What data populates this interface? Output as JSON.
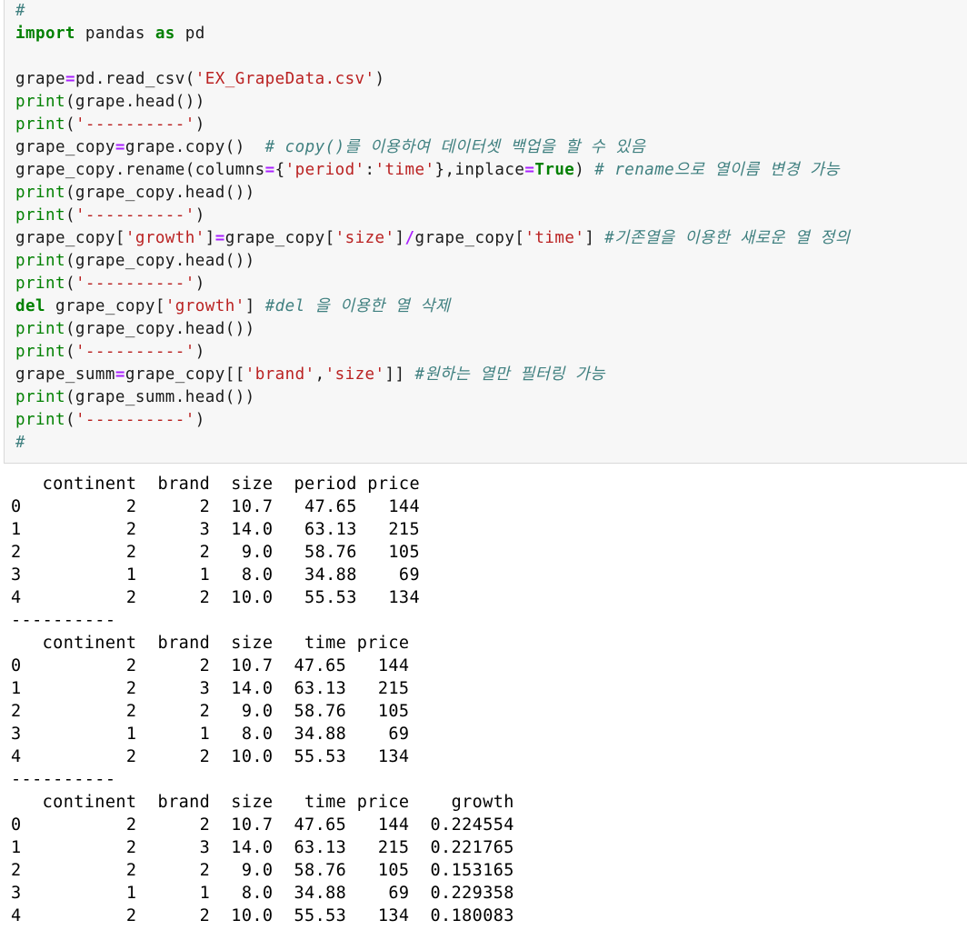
{
  "code_cell": {
    "lines": [
      [
        {
          "t": "#",
          "c": "cm"
        }
      ],
      [
        {
          "t": "import",
          "c": "kw"
        },
        {
          "t": " pandas ",
          "c": ""
        },
        {
          "t": "as",
          "c": "kw"
        },
        {
          "t": " pd",
          "c": ""
        }
      ],
      [
        {
          "t": "",
          "c": ""
        }
      ],
      [
        {
          "t": "grape",
          "c": ""
        },
        {
          "t": "=",
          "c": "op"
        },
        {
          "t": "pd.read_csv(",
          "c": ""
        },
        {
          "t": "'EX_GrapeData.csv'",
          "c": "str"
        },
        {
          "t": ")",
          "c": ""
        }
      ],
      [
        {
          "t": "print",
          "c": "builtin"
        },
        {
          "t": "(grape.head())",
          "c": ""
        }
      ],
      [
        {
          "t": "print",
          "c": "builtin"
        },
        {
          "t": "(",
          "c": ""
        },
        {
          "t": "'----------'",
          "c": "str"
        },
        {
          "t": ")",
          "c": ""
        }
      ],
      [
        {
          "t": "grape_copy",
          "c": ""
        },
        {
          "t": "=",
          "c": "op"
        },
        {
          "t": "grape.copy()  ",
          "c": ""
        },
        {
          "t": "# copy()를 이용하여 데이터셋 백업을 할 수 있음",
          "c": "cm"
        }
      ],
      [
        {
          "t": "grape_copy.rename(columns",
          "c": ""
        },
        {
          "t": "=",
          "c": "op"
        },
        {
          "t": "{",
          "c": ""
        },
        {
          "t": "'period'",
          "c": "str"
        },
        {
          "t": ":",
          "c": ""
        },
        {
          "t": "'time'",
          "c": "str"
        },
        {
          "t": "},inplace",
          "c": ""
        },
        {
          "t": "=",
          "c": "op"
        },
        {
          "t": "True",
          "c": "kw"
        },
        {
          "t": ") ",
          "c": ""
        },
        {
          "t": "# rename으로 열이름 변경 가능",
          "c": "cm"
        }
      ],
      [
        {
          "t": "print",
          "c": "builtin"
        },
        {
          "t": "(grape_copy.head())",
          "c": ""
        }
      ],
      [
        {
          "t": "print",
          "c": "builtin"
        },
        {
          "t": "(",
          "c": ""
        },
        {
          "t": "'----------'",
          "c": "str"
        },
        {
          "t": ")",
          "c": ""
        }
      ],
      [
        {
          "t": "grape_copy[",
          "c": ""
        },
        {
          "t": "'growth'",
          "c": "str"
        },
        {
          "t": "]",
          "c": ""
        },
        {
          "t": "=",
          "c": "op"
        },
        {
          "t": "grape_copy[",
          "c": ""
        },
        {
          "t": "'size'",
          "c": "str"
        },
        {
          "t": "]",
          "c": ""
        },
        {
          "t": "/",
          "c": "op"
        },
        {
          "t": "grape_copy[",
          "c": ""
        },
        {
          "t": "'time'",
          "c": "str"
        },
        {
          "t": "] ",
          "c": ""
        },
        {
          "t": "#기존열을 이용한 새로운 열 정의",
          "c": "cm"
        }
      ],
      [
        {
          "t": "print",
          "c": "builtin"
        },
        {
          "t": "(grape_copy.head())",
          "c": ""
        }
      ],
      [
        {
          "t": "print",
          "c": "builtin"
        },
        {
          "t": "(",
          "c": ""
        },
        {
          "t": "'----------'",
          "c": "str"
        },
        {
          "t": ")",
          "c": ""
        }
      ],
      [
        {
          "t": "del",
          "c": "kw"
        },
        {
          "t": " grape_copy[",
          "c": ""
        },
        {
          "t": "'growth'",
          "c": "str"
        },
        {
          "t": "] ",
          "c": ""
        },
        {
          "t": "#del 을 이용한 열 삭제",
          "c": "cm"
        }
      ],
      [
        {
          "t": "print",
          "c": "builtin"
        },
        {
          "t": "(grape_copy.head())",
          "c": ""
        }
      ],
      [
        {
          "t": "print",
          "c": "builtin"
        },
        {
          "t": "(",
          "c": ""
        },
        {
          "t": "'----------'",
          "c": "str"
        },
        {
          "t": ")",
          "c": ""
        }
      ],
      [
        {
          "t": "grape_summ",
          "c": ""
        },
        {
          "t": "=",
          "c": "op"
        },
        {
          "t": "grape_copy[[",
          "c": ""
        },
        {
          "t": "'brand'",
          "c": "str"
        },
        {
          "t": ",",
          "c": ""
        },
        {
          "t": "'size'",
          "c": "str"
        },
        {
          "t": "]] ",
          "c": ""
        },
        {
          "t": "#원하는 열만 필터링 가능",
          "c": "cm"
        }
      ],
      [
        {
          "t": "print",
          "c": "builtin"
        },
        {
          "t": "(grape_summ.head())",
          "c": ""
        }
      ],
      [
        {
          "t": "print",
          "c": "builtin"
        },
        {
          "t": "(",
          "c": ""
        },
        {
          "t": "'----------'",
          "c": "str"
        },
        {
          "t": ")",
          "c": ""
        }
      ],
      [
        {
          "t": "#",
          "c": "cm"
        }
      ]
    ]
  },
  "output_cell": {
    "lines": [
      "   continent  brand  size  period price",
      "0          2      2  10.7   47.65   144",
      "1          2      3  14.0   63.13   215",
      "2          2      2   9.0   58.76   105",
      "3          1      1   8.0   34.88    69",
      "4          2      2  10.0   55.53   134",
      "----------",
      "   continent  brand  size   time price",
      "0          2      2  10.7  47.65   144",
      "1          2      3  14.0  63.13   215",
      "2          2      2   9.0  58.76   105",
      "3          1      1   8.0  34.88    69",
      "4          2      2  10.0  55.53   134",
      "----------",
      "   continent  brand  size   time price    growth",
      "0          2      2  10.7  47.65   144  0.224554",
      "1          2      3  14.0  63.13   215  0.221765",
      "2          2      2   9.0  58.76   105  0.153165",
      "3          1      1   8.0  34.88    69  0.229358",
      "4          2      2  10.0  55.53   134  0.180083"
    ]
  }
}
